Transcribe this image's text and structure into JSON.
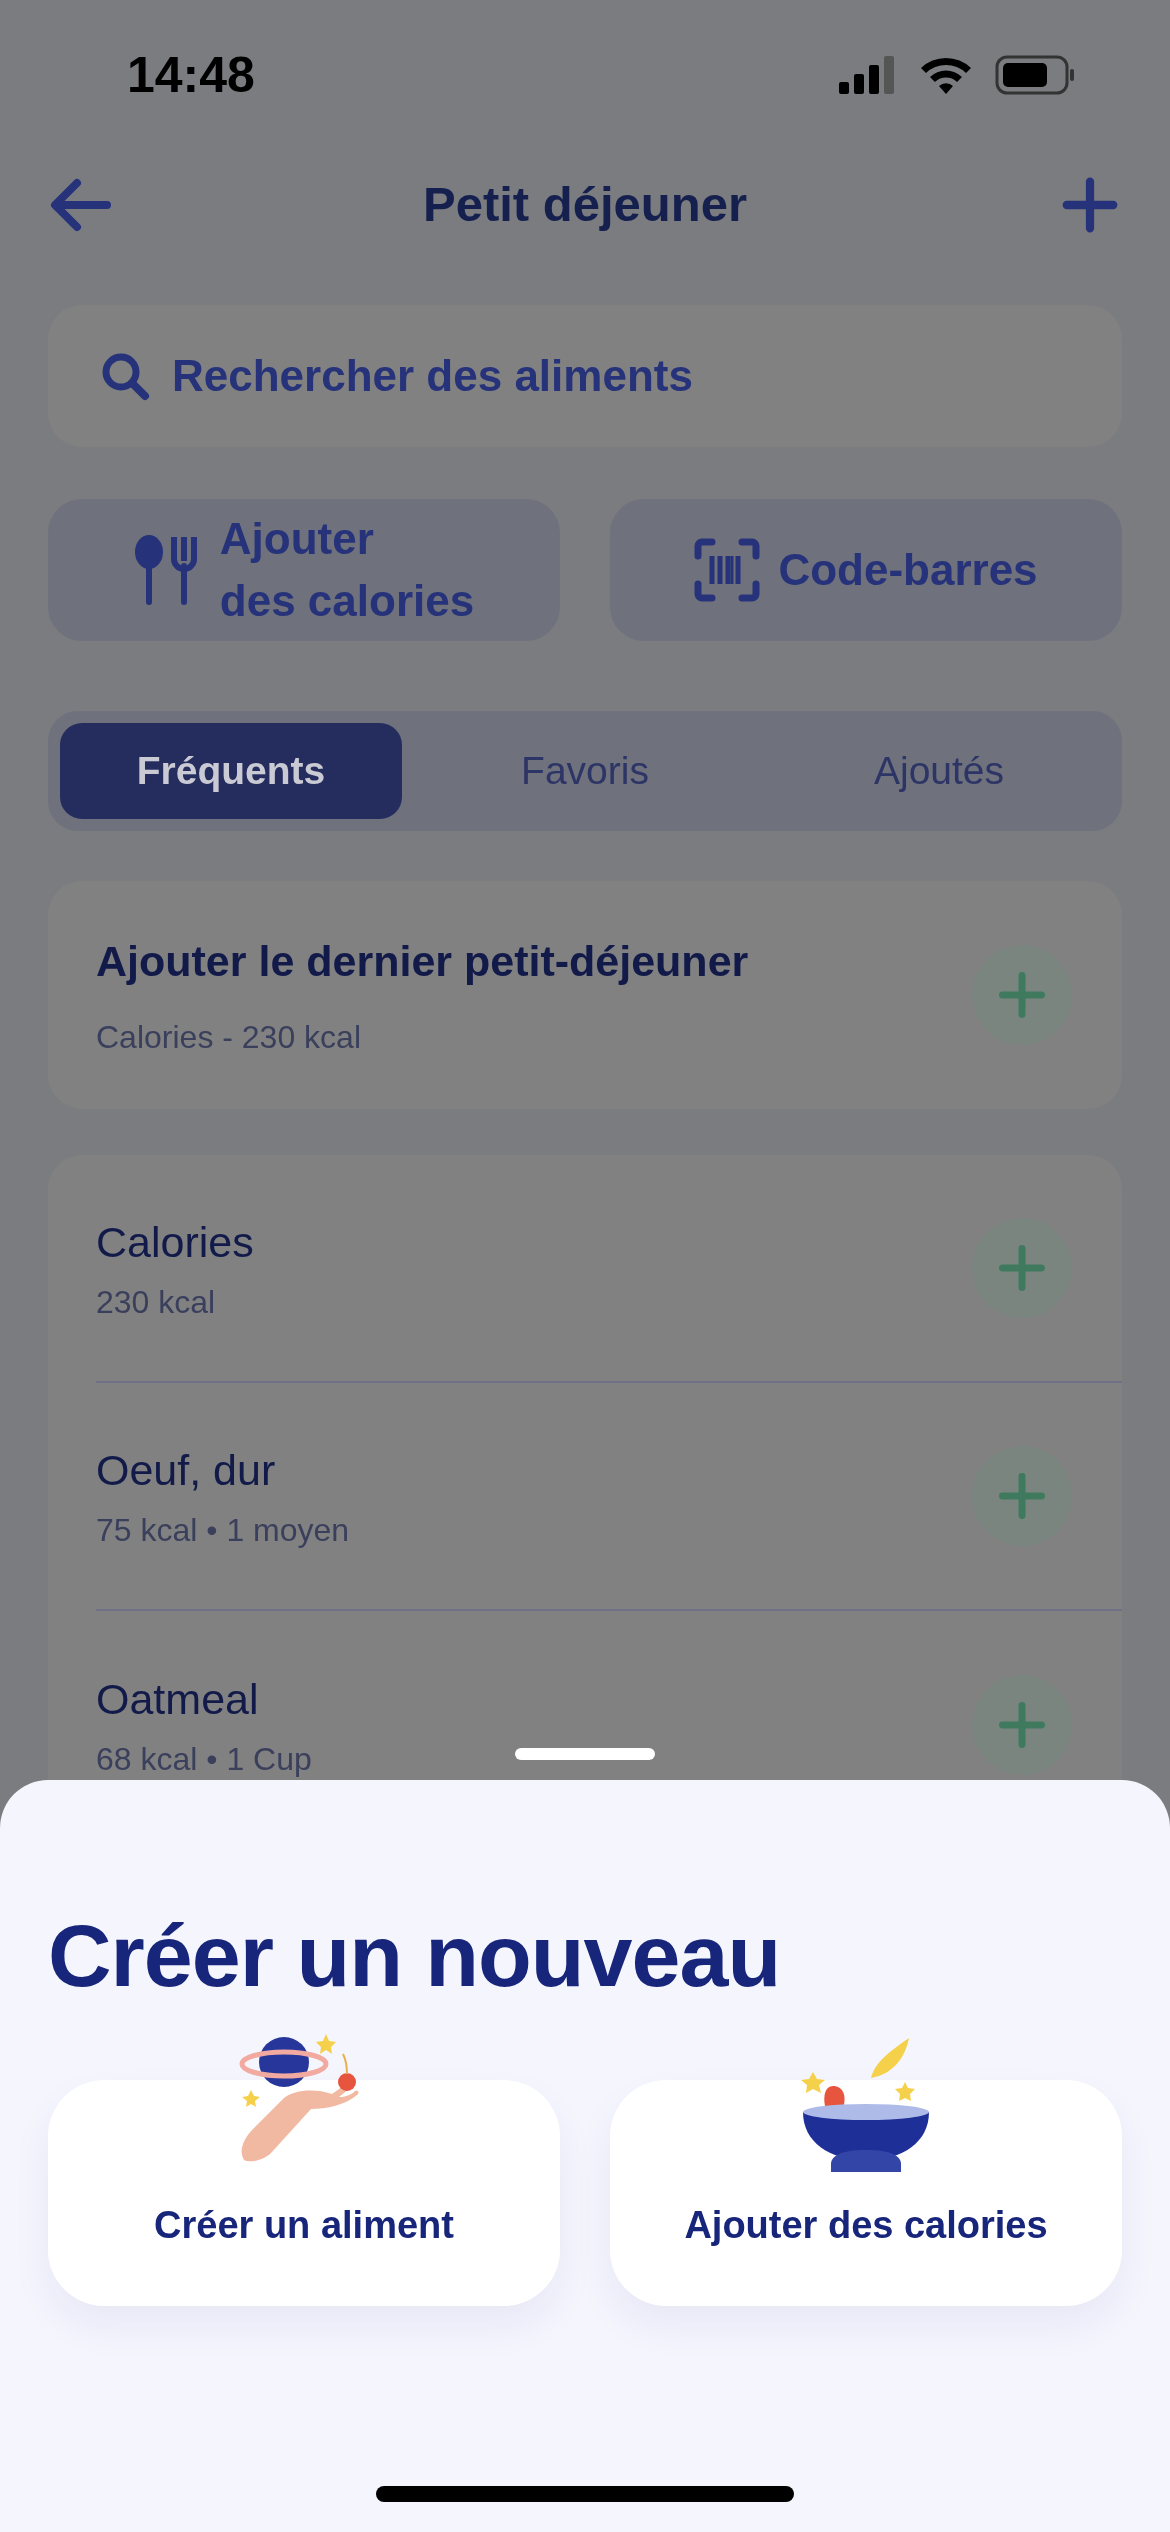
{
  "status_bar": {
    "time": "14:48"
  },
  "header": {
    "title": "Petit déjeuner"
  },
  "search": {
    "placeholder": "Rechercher des aliments"
  },
  "quick_actions": [
    {
      "kind": "calories",
      "label": "Ajouter\ndes calories"
    },
    {
      "kind": "barcode",
      "label": "Code-barres"
    }
  ],
  "tabs": [
    {
      "label": "Fréquents",
      "selected": true
    },
    {
      "label": "Favoris",
      "selected": false
    },
    {
      "label": "Ajoutés",
      "selected": false
    }
  ],
  "last_meal": {
    "title": "Ajouter le dernier petit-déjeuner",
    "subtitle": "Calories - 230 kcal"
  },
  "foods": [
    {
      "name": "Calories",
      "detail": "230 kcal"
    },
    {
      "name": "Oeuf, dur",
      "detail": "75 kcal • 1 moyen"
    },
    {
      "name": "Oatmeal",
      "detail": "68 kcal • 1 Cup"
    }
  ],
  "sheet": {
    "title": "Créer un nouveau",
    "options": [
      {
        "kind": "food",
        "label": "Créer un aliment"
      },
      {
        "kind": "calories",
        "label": "Ajouter des calories"
      }
    ]
  }
}
